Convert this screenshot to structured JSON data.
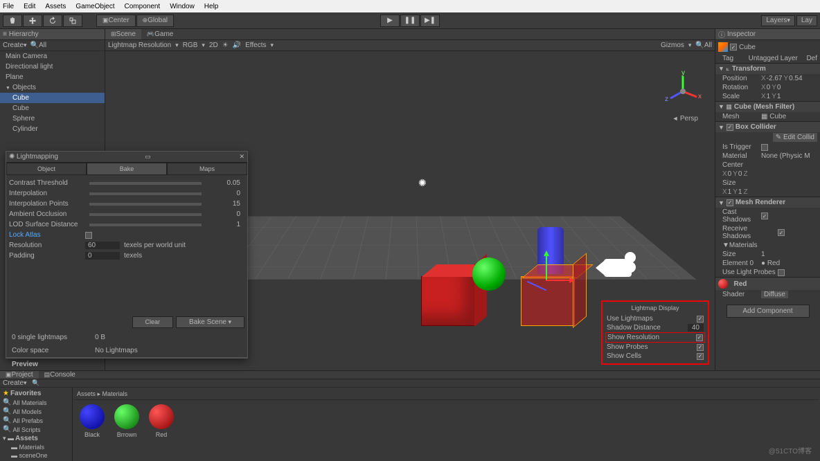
{
  "menu": [
    "File",
    "Edit",
    "Assets",
    "GameObject",
    "Component",
    "Window",
    "Help"
  ],
  "toolbar": {
    "pivot1": "Center",
    "pivot2": "Global",
    "layers": "Layers",
    "layout": "Lay"
  },
  "hierarchy": {
    "tab": "Hierarchy",
    "create": "Create",
    "search": "All",
    "items": [
      {
        "label": "Main Camera",
        "sel": false,
        "child": false
      },
      {
        "label": "Directional light",
        "sel": false,
        "child": false
      },
      {
        "label": "Plane",
        "sel": false,
        "child": false
      },
      {
        "label": "Objects",
        "sel": false,
        "child": false,
        "parent": true
      },
      {
        "label": "Cube",
        "sel": true,
        "child": true
      },
      {
        "label": "Cube",
        "sel": false,
        "child": true
      },
      {
        "label": "Sphere",
        "sel": false,
        "child": true
      },
      {
        "label": "Cylinder",
        "sel": false,
        "child": true
      }
    ]
  },
  "scene": {
    "tabs": [
      "Scene",
      "Game"
    ],
    "active": 0,
    "bar": {
      "res": "Lightmap Resolution",
      "rgb": "RGB",
      "dim": "2D",
      "fx": "Effects",
      "gizmos": "Gizmos",
      "all": "All"
    },
    "persp": "Persp"
  },
  "lightmapping": {
    "title": "Lightmapping",
    "tabs": [
      "Object",
      "Bake",
      "Maps"
    ],
    "active": 1,
    "props": [
      {
        "k": "Contrast Threshold",
        "v": "0.05"
      },
      {
        "k": "Interpolation",
        "v": "0"
      },
      {
        "k": "Interpolation Points",
        "v": "15"
      },
      {
        "k": "Ambient Occlusion",
        "v": "0"
      },
      {
        "k": "LOD Surface Distance",
        "v": "1"
      }
    ],
    "lock": "Lock Atlas",
    "res": {
      "k": "Resolution",
      "v": "60",
      "u": "texels per world unit"
    },
    "pad": {
      "k": "Padding",
      "v": "0",
      "u": "texels"
    },
    "btn1": "Clear",
    "btn2": "Bake Scene",
    "info1": {
      "k": "0 single lightmaps",
      "v": "0 B"
    },
    "info2": {
      "k": "Color space",
      "v": "No Lightmaps"
    },
    "preview": "Preview"
  },
  "lmDisplay": {
    "title": "Lightmap Display",
    "rows": [
      {
        "lbl": "Use Lightmaps",
        "chk": true,
        "hl": false
      },
      {
        "lbl": "Shadow Distance",
        "val": "40",
        "hl": false
      },
      {
        "lbl": "Show Resolution",
        "chk": true,
        "hl": true
      },
      {
        "lbl": "Show Probes",
        "chk": true,
        "hl": false
      },
      {
        "lbl": "Show Cells",
        "chk": true,
        "hl": false
      }
    ]
  },
  "inspector": {
    "tab": "Inspector",
    "name": "Cube",
    "tag": "Tag",
    "tagv": "Untagged",
    "layer": "Layer",
    "layerv": "Def",
    "transform": {
      "title": "Transform",
      "pos": {
        "k": "Position",
        "x": "-2.67",
        "y": "0.54"
      },
      "rot": {
        "k": "Rotation",
        "x": "0",
        "y": "0"
      },
      "scl": {
        "k": "Scale",
        "x": "1",
        "y": "1"
      }
    },
    "meshfilter": {
      "title": "Cube (Mesh Filter)",
      "mesh": "Mesh",
      "meshv": "Cube"
    },
    "collider": {
      "title": "Box Collider",
      "edit": "Edit Collid",
      "trig": "Is Trigger",
      "mat": "Material",
      "matv": "None (Physic M",
      "center": "Center",
      "cx": "0",
      "cy": "0",
      "size": "Size",
      "sx": "1",
      "sy": "1"
    },
    "renderer": {
      "title": "Mesh Renderer",
      "cast": "Cast Shadows",
      "recv": "Receive Shadows",
      "mats": "Materials",
      "size": "Size",
      "sizev": "1",
      "el": "Element 0",
      "elv": "Red",
      "probes": "Use Light Probes"
    },
    "mat": {
      "name": "Red",
      "shader": "Shader",
      "shaderv": "Diffuse"
    },
    "add": "Add Component"
  },
  "project": {
    "tabs": [
      "Project",
      "Console"
    ],
    "create": "Create",
    "favorites": "Favorites",
    "favs": [
      "All Materials",
      "All Models",
      "All Prefabs",
      "All Scripts"
    ],
    "assets": "Assets",
    "folders": [
      "Materials",
      "sceneOne"
    ],
    "crumb": "Assets ▸ Materials",
    "items": [
      {
        "name": "Black",
        "color": "radial-gradient(circle at 30% 30%,#44f,#008)"
      },
      {
        "name": "Brrown",
        "color": "radial-gradient(circle at 30% 30%,#6f6,#060)"
      },
      {
        "name": "Red",
        "color": "radial-gradient(circle at 30% 30%,#f55,#800)"
      }
    ]
  },
  "watermark": "@51CTO博客"
}
